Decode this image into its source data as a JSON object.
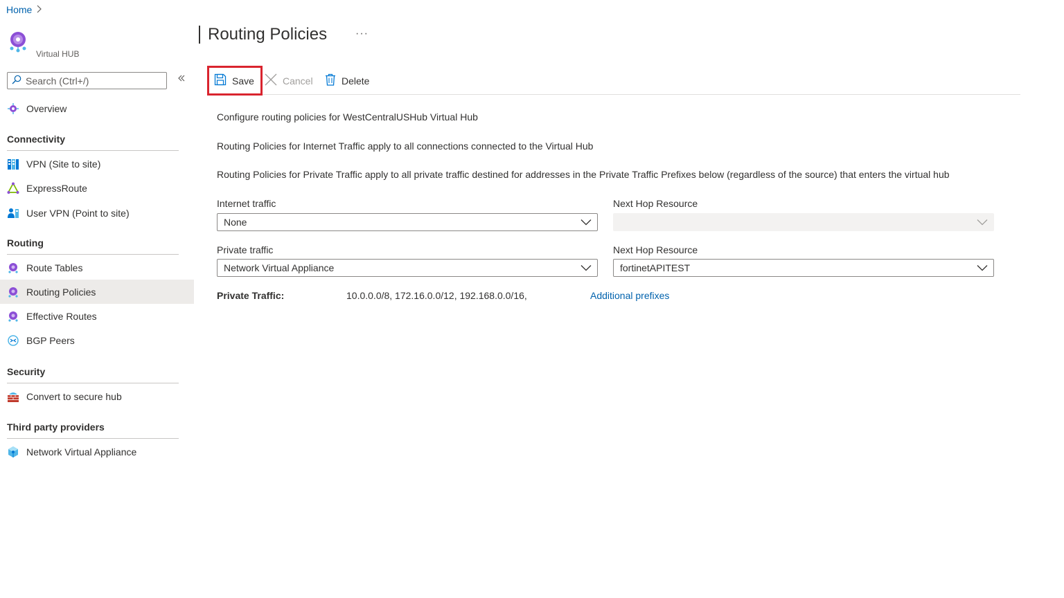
{
  "breadcrumb": {
    "home": "Home"
  },
  "resource": {
    "type_label": "Virtual HUB"
  },
  "page": {
    "title": "Routing Policies",
    "more": "···"
  },
  "search": {
    "placeholder": "Search (Ctrl+/)"
  },
  "nav": {
    "overview": "Overview",
    "connectivity": {
      "header": "Connectivity",
      "items": [
        "VPN (Site to site)",
        "ExpressRoute",
        "User VPN (Point to site)"
      ]
    },
    "routing": {
      "header": "Routing",
      "items": [
        "Route Tables",
        "Routing Policies",
        "Effective Routes",
        "BGP Peers"
      ],
      "selected": "Routing Policies"
    },
    "security": {
      "header": "Security",
      "items": [
        "Convert to secure hub"
      ]
    },
    "third_party": {
      "header": "Third party providers",
      "items": [
        "Network Virtual Appliance"
      ]
    }
  },
  "toolbar": {
    "save": "Save",
    "cancel": "Cancel",
    "delete": "Delete"
  },
  "content": {
    "desc1": "Configure routing policies for WestCentralUSHub Virtual Hub",
    "desc2": "Routing Policies for Internet Traffic apply to all connections connected to the Virtual Hub",
    "desc3": "Routing Policies for Private Traffic apply to all private traffic destined for addresses in the Private Traffic Prefixes below (regardless of the source) that enters the virtual hub",
    "internet_label": "Internet traffic",
    "internet_value": "None",
    "next_hop_label_1": "Next Hop Resource",
    "next_hop_value_1": "",
    "private_label": "Private traffic",
    "private_value": "Network Virtual Appliance",
    "next_hop_label_2": "Next Hop Resource",
    "next_hop_value_2": "fortinetAPITEST",
    "private_traffic_label": "Private Traffic:",
    "private_traffic_prefixes": "10.0.0.0/8, 172.16.0.0/12, 192.168.0.0/16,",
    "additional_prefixes": "Additional prefixes"
  },
  "colors": {
    "link": "#0062ad",
    "highlight": "#d9242e",
    "selected_bg": "#edebe9"
  }
}
